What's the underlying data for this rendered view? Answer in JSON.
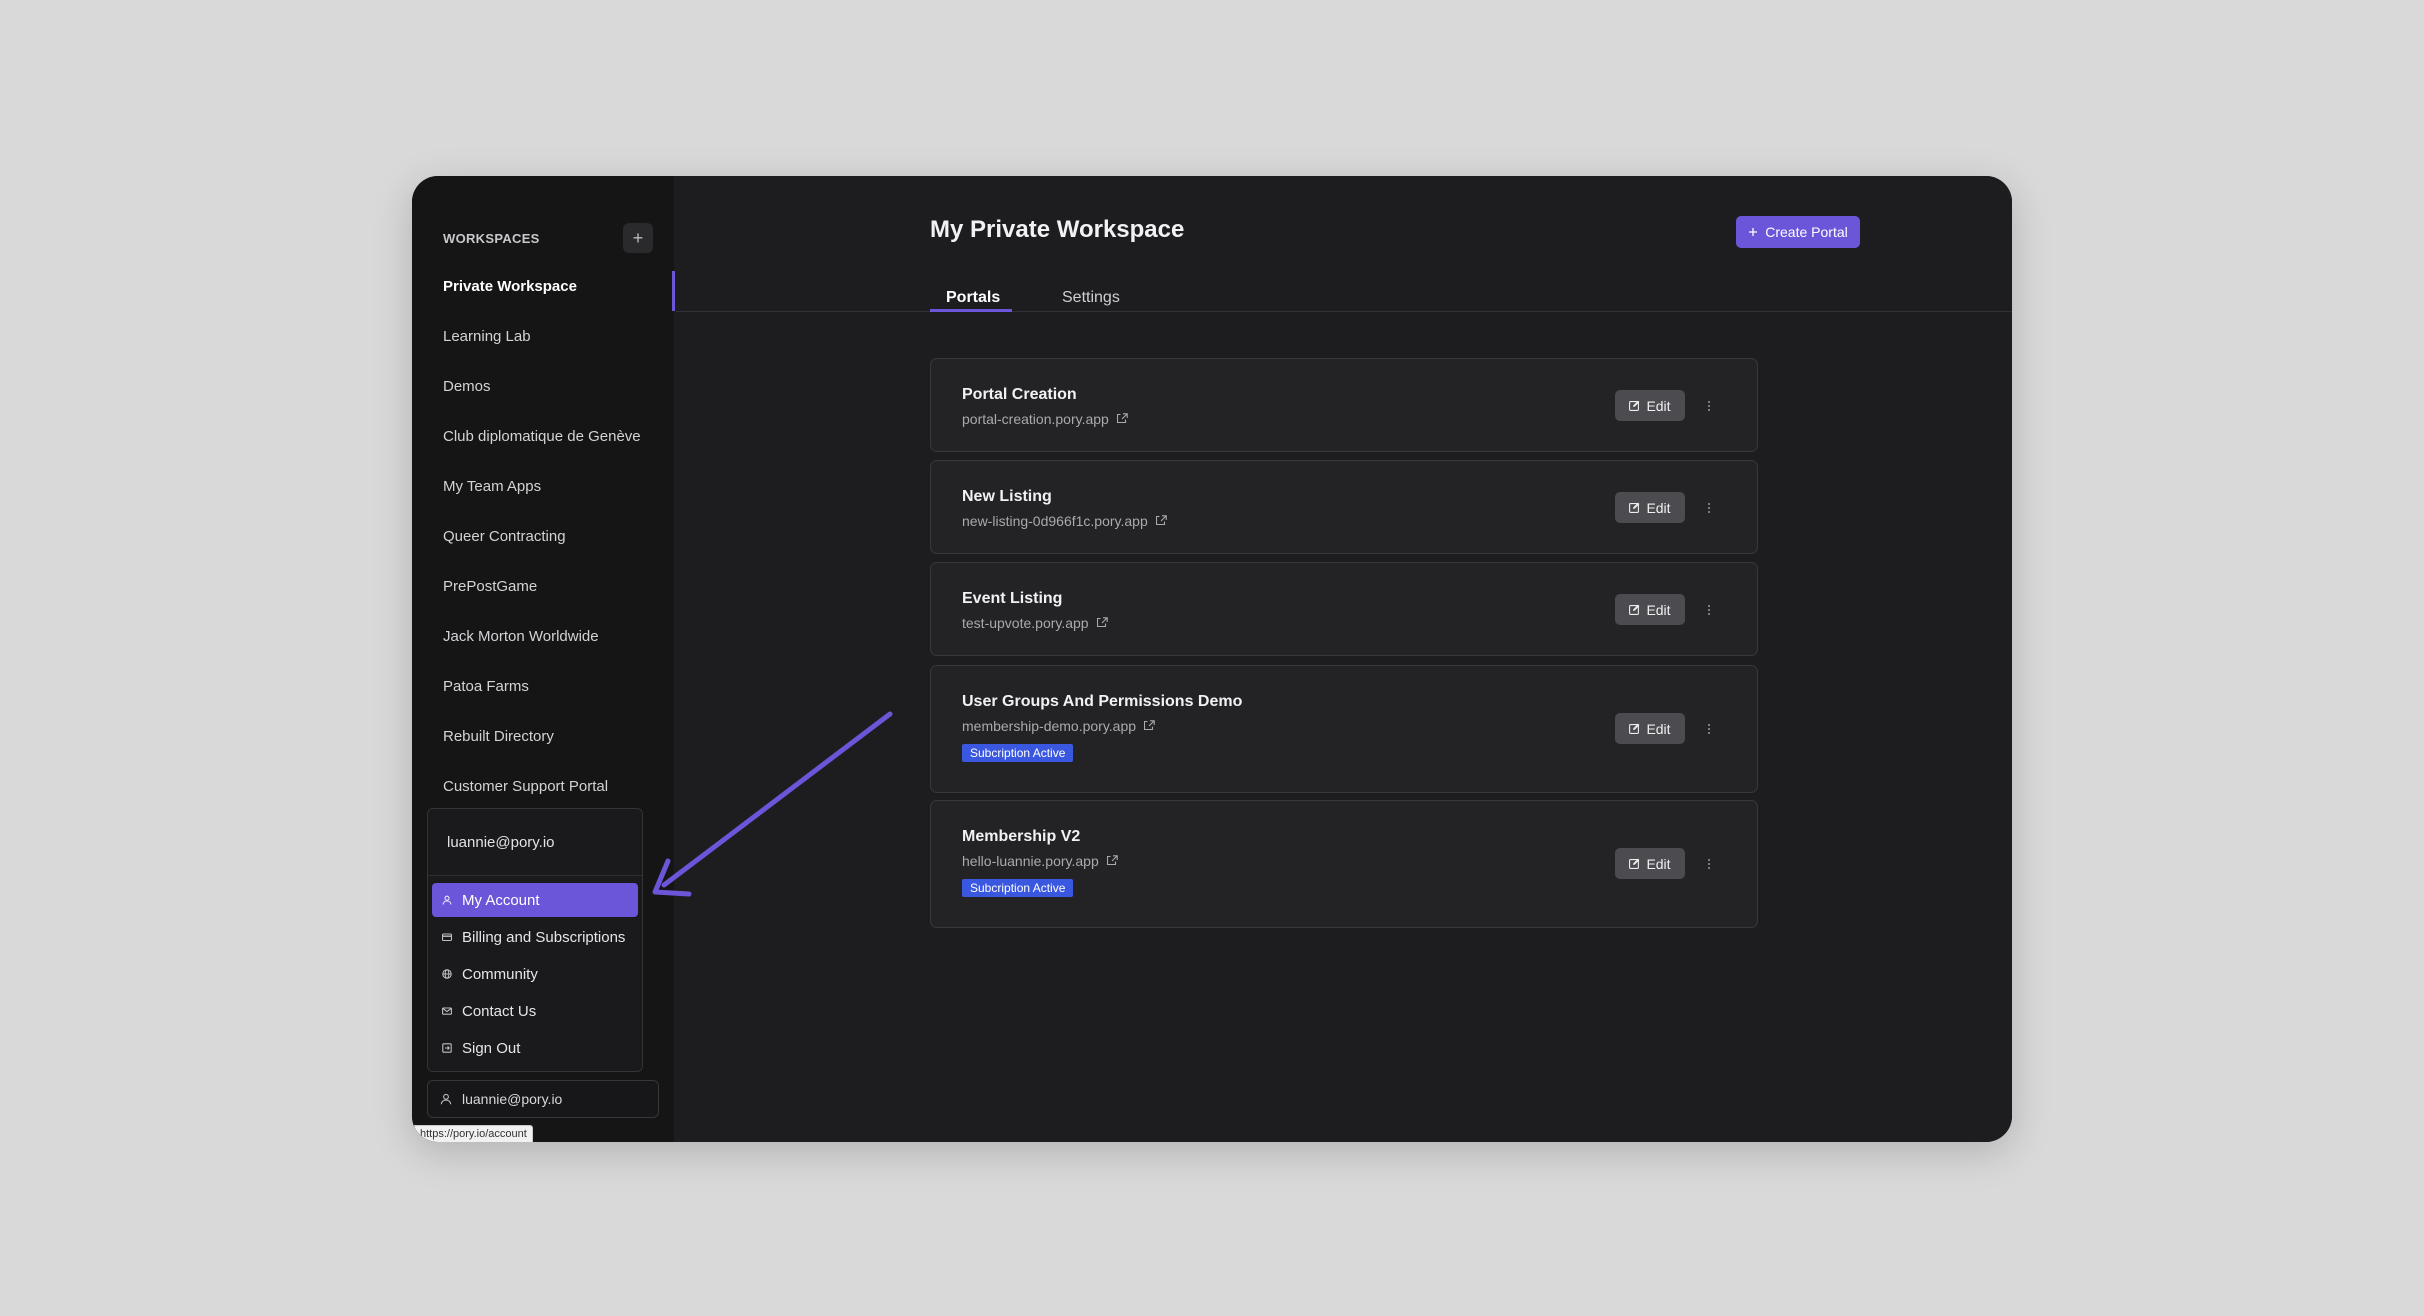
{
  "sidebar": {
    "workspaces_label": "WORKSPACES",
    "add_label": "+",
    "items": [
      {
        "label": "Private Workspace"
      },
      {
        "label": "Learning Lab"
      },
      {
        "label": "Demos"
      },
      {
        "label": "Club diplomatique de Genève"
      },
      {
        "label": "My Team Apps"
      },
      {
        "label": "Queer Contracting"
      },
      {
        "label": "PrePostGame"
      },
      {
        "label": "Jack Morton Worldwide"
      },
      {
        "label": "Patoa Farms"
      },
      {
        "label": "Rebuilt Directory"
      },
      {
        "label": "Customer Support Portal"
      }
    ],
    "menu": {
      "email": "luannie@pory.io",
      "items": [
        {
          "label": "My Account",
          "icon": "user-icon"
        },
        {
          "label": "Billing and Subscriptions",
          "icon": "card-icon"
        },
        {
          "label": "Community",
          "icon": "globe-icon"
        },
        {
          "label": "Contact Us",
          "icon": "mail-icon"
        },
        {
          "label": "Sign Out",
          "icon": "logout-icon"
        }
      ]
    },
    "user_email": "luannie@pory.io",
    "status_url": "https://pory.io/account"
  },
  "main": {
    "title": "My Private Workspace",
    "create_label": "Create Portal",
    "tabs": [
      {
        "label": "Portals"
      },
      {
        "label": "Settings"
      }
    ],
    "portals": [
      {
        "name": "Portal Creation",
        "url": "portal-creation.pory.app",
        "badge": ""
      },
      {
        "name": "New Listing",
        "url": "new-listing-0d966f1c.pory.app",
        "badge": ""
      },
      {
        "name": "Event Listing",
        "url": "test-upvote.pory.app",
        "badge": ""
      },
      {
        "name": "User Groups And Permissions Demo",
        "url": "membership-demo.pory.app",
        "badge": "Subcription Active"
      },
      {
        "name": "Membership V2",
        "url": "hello-luannie.pory.app",
        "badge": "Subcription Active"
      }
    ],
    "edit_label": "Edit"
  },
  "colors": {
    "accent": "#6b55d9",
    "badge": "#3a57e0",
    "background": "#d9d9d9",
    "panel": "#1d1d1f"
  }
}
